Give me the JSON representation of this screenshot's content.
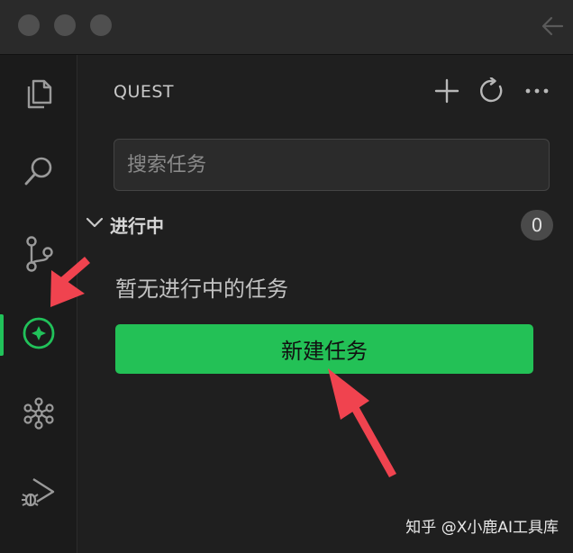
{
  "titlebar": {
    "window_controls": [
      "close",
      "minimize",
      "maximize"
    ],
    "back_icon": "arrow-left-icon"
  },
  "activity_bar": {
    "items": [
      {
        "icon": "files-icon"
      },
      {
        "icon": "search-icon"
      },
      {
        "icon": "source-control-icon"
      },
      {
        "icon": "compass-icon",
        "active": true
      },
      {
        "icon": "graph-icon"
      },
      {
        "icon": "run-debug-icon"
      }
    ],
    "active_color": "#21c25a"
  },
  "panel": {
    "title": "QUEST",
    "actions": [
      "plus-icon",
      "refresh-icon",
      "more-icon"
    ],
    "search": {
      "placeholder": "搜索任务",
      "value": ""
    },
    "section": {
      "label": "进行中",
      "count": "0",
      "expanded": true
    },
    "empty_message": "暂无进行中的任务",
    "new_task_label": "新建任务",
    "accent_color": "#23c156"
  },
  "annotations": {
    "arrow_color": "#f0434f",
    "arrows": [
      "points-to-compass-icon",
      "points-to-new-task-button"
    ]
  },
  "watermark": "知乎 @X小鹿AI工具库"
}
